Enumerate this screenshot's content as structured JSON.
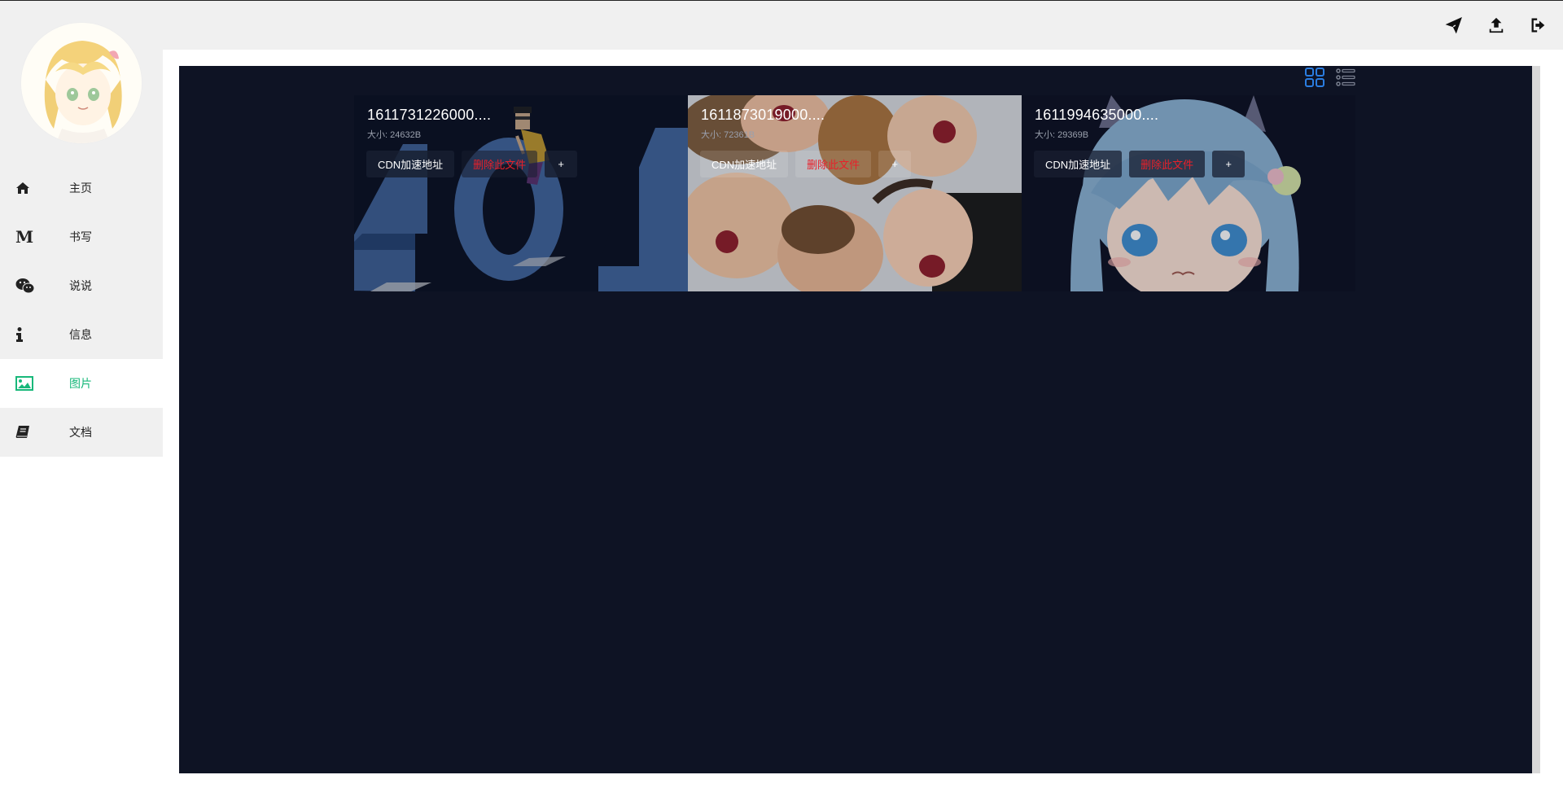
{
  "header": {
    "actions": [
      {
        "icon": "paper-plane-icon"
      },
      {
        "icon": "upload-icon"
      },
      {
        "icon": "sign-out-icon"
      }
    ]
  },
  "sidebar": {
    "items": [
      {
        "label": "主页",
        "icon": "home-icon"
      },
      {
        "label": "书写",
        "icon": "markdown-icon"
      },
      {
        "label": "说说",
        "icon": "wechat-icon"
      },
      {
        "label": "信息",
        "icon": "info-icon"
      },
      {
        "label": "图片",
        "icon": "image-icon",
        "active": true
      },
      {
        "label": "文档",
        "icon": "book-icon"
      }
    ]
  },
  "files": [
    {
      "name": "1611731226000....",
      "size": "大小: 24632B",
      "cdn_label": "CDN加速地址",
      "delete_label": "删除此文件",
      "more_label": "+"
    },
    {
      "name": "1611873019000....",
      "size": "大小: 72361B",
      "cdn_label": "CDN加速地址",
      "delete_label": "删除此文件",
      "more_label": "+"
    },
    {
      "name": "1611994635000....",
      "size": "大小: 29369B",
      "cdn_label": "CDN加速地址",
      "delete_label": "删除此文件",
      "more_label": "+"
    }
  ],
  "colors": {
    "accent": "#18b87a",
    "panel_bg": "#0e1324",
    "danger": "#e8202a",
    "toggle_active": "#2a7de1"
  }
}
